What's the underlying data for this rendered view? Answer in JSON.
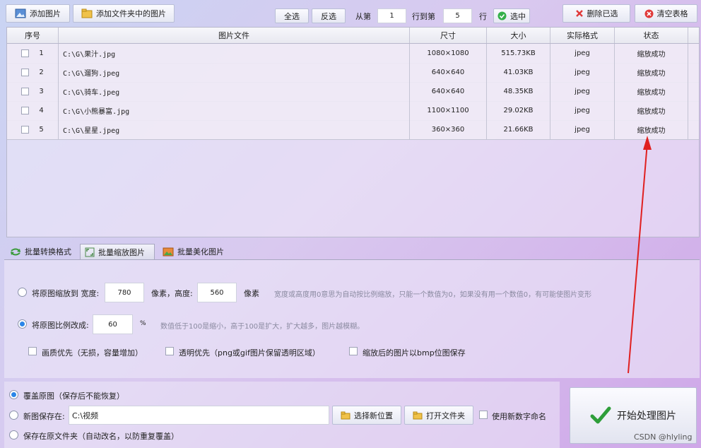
{
  "toolbar": {
    "add_images": "添加图片",
    "add_folder_images": "添加文件夹中的图片",
    "select_all": "全选",
    "invert": "反选",
    "from_label": "从第",
    "from_value": "1",
    "to_label": "行到第",
    "to_value": "5",
    "row_label": "行",
    "select": "选中",
    "delete_selected": "删除已选",
    "clear_table": "清空表格"
  },
  "table": {
    "headers": [
      "序号",
      "图片文件",
      "尺寸",
      "大小",
      "实际格式",
      "状态"
    ],
    "rows": [
      {
        "index": "1",
        "file": "C:\\G\\果汁.jpg",
        "size": "1080×1080",
        "bytes": "515.73KB",
        "format": "jpeg",
        "status": "缩放成功"
      },
      {
        "index": "2",
        "file": "C:\\G\\遛狗.jpeg",
        "size": "640×640",
        "bytes": "41.03KB",
        "format": "jpeg",
        "status": "缩放成功"
      },
      {
        "index": "3",
        "file": "C:\\G\\骑车.jpeg",
        "size": "640×640",
        "bytes": "48.35KB",
        "format": "jpeg",
        "status": "缩放成功"
      },
      {
        "index": "4",
        "file": "C:\\G\\小熊暴富.jpg",
        "size": "1100×1100",
        "bytes": "29.02KB",
        "format": "jpeg",
        "status": "缩放成功"
      },
      {
        "index": "5",
        "file": "C:\\G\\星星.jpeg",
        "size": "360×360",
        "bytes": "21.66KB",
        "format": "jpeg",
        "status": "缩放成功"
      }
    ]
  },
  "tabs": {
    "convert": "批量转换格式",
    "resize": "批量缩放图片",
    "beautify": "批量美化图片"
  },
  "resize": {
    "opt1_label": "将原图缩放到 宽度:",
    "width_value": "780",
    "height_label": "像素，高度:",
    "height_value": "560",
    "pixel_label": "像素",
    "hint1": "宽度或高度用0意思为自动按比例缩放，只能一个数值为0，如果没有用一个数值0，有可能使图片变形",
    "opt2_label": "将原图比例改成:",
    "ratio_value": "60",
    "percent": "%",
    "hint2": "数值低于100是缩小，高于100是扩大，扩大越多，图片越模糊。",
    "quality_first": "画质优先（无损，容量增加）",
    "transparent_first": "透明优先（png或gif图片保留透明区域）",
    "save_bmp": "缩放后的图片以bmp位图保存"
  },
  "save": {
    "overwrite": "覆盖原图（保存后不能恢复）",
    "new_location_label": "新图保存在:",
    "new_location_value": "C:\\视频",
    "choose_location": "选择新位置",
    "open_folder": "打开文件夹",
    "numeric_name": "使用新数字命名",
    "original_folder": "保存在原文件夹（自动改名，以防重复覆盖）"
  },
  "start_button": "开始处理图片",
  "watermark": "CSDN @hlyling"
}
